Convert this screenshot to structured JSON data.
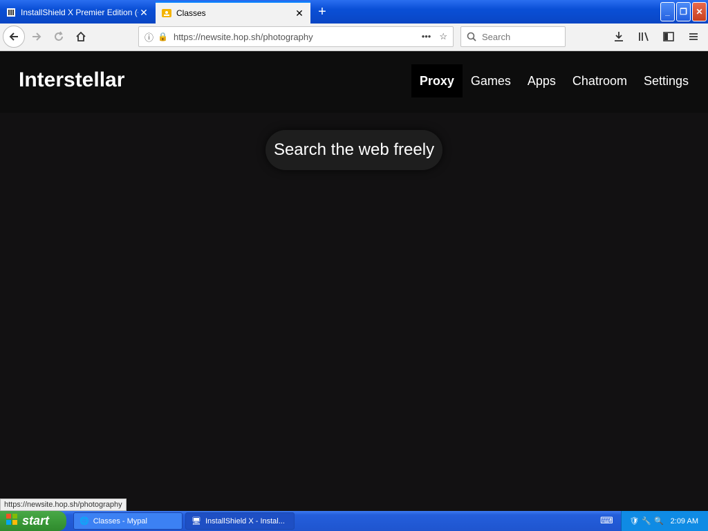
{
  "browser": {
    "tabs": [
      {
        "title": "InstallShield X Premier Edition (+U",
        "icon": "installshield-icon",
        "active": false
      },
      {
        "title": "Classes",
        "icon": "classroom-icon",
        "active": true
      }
    ],
    "new_tab_label": "+",
    "window_buttons": {
      "minimize": "_",
      "restore": "❐",
      "close": "✕"
    },
    "url": "https://newsite.hop.sh/photography",
    "search_placeholder": "Search",
    "status_url": "https://newsite.hop.sh/photography"
  },
  "site": {
    "logo": "Interstellar",
    "nav": [
      {
        "label": "Proxy",
        "active": true
      },
      {
        "label": "Games"
      },
      {
        "label": "Apps"
      },
      {
        "label": "Chatroom"
      },
      {
        "label": "Settings"
      }
    ],
    "hero_text": "Search the web freely"
  },
  "taskbar": {
    "start_label": "start",
    "tasks": [
      {
        "label": "Classes - Mypal",
        "icon": "mypal-icon"
      },
      {
        "label": "InstallShield X - Instal...",
        "icon": "installshield-icon"
      }
    ],
    "clock": "2:09 AM"
  },
  "colors": {
    "page_bg": "#121112",
    "accent": "#0a84ff",
    "xp_blue": "#245edb",
    "start_green": "#3b9a39"
  }
}
